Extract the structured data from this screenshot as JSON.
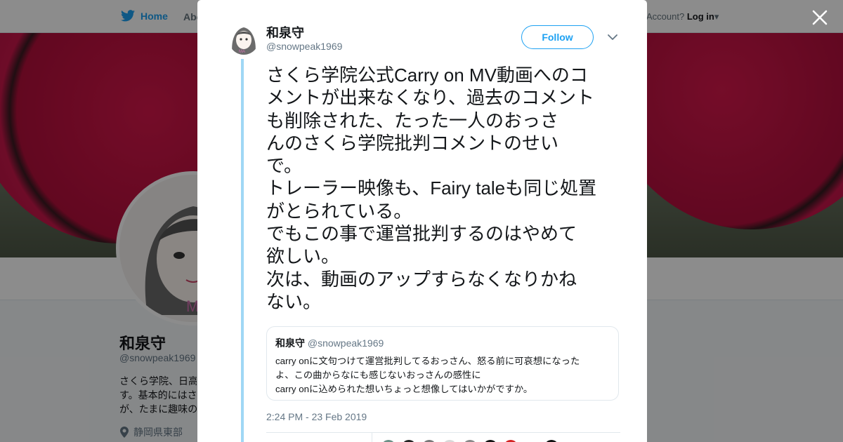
{
  "topnav": {
    "home_label": "Home",
    "about_label": "Abo",
    "account_prompt": "Account?",
    "login_label": "Log in"
  },
  "profile": {
    "name": "和泉守",
    "handle": "@snowpeak1969",
    "bio_lines": [
      "さくら学院、日高",
      "す。基本的にはさ",
      "が、たまに趣味の"
    ],
    "location": "静岡県東部"
  },
  "tweet": {
    "author_name": "和泉守",
    "author_handle": "@snowpeak1969",
    "follow_label": "Follow",
    "text_lines": [
      "さくら学院公式Carry on MV動画へのコ",
      "メントが出来なくなり、過去のコメント",
      "も削除された、たった一人のおっさ",
      "んのさくら学院批判コメントのせい",
      "で。",
      "トレーラー映像も、Fairy taleも同じ処置",
      "がとられている。",
      "でもこの事で運営批判するのはやめて",
      "欲しい。",
      "次は、動画のアップすらなくなりかね",
      "ない。"
    ],
    "timestamp": "2:24 PM - 23 Feb 2019"
  },
  "quoted_tweet": {
    "author_name": "和泉守",
    "author_handle": "@snowpeak1969",
    "text_lines": [
      "carry onに文句つけて運営批判してるおっさん、怒る前に可哀想になった",
      "よ、この曲からなにも感じないおっさんの感性に",
      "carry onに込められた想いちょっと想像してはいかがですか。"
    ]
  },
  "colors": {
    "accent": "#1da1f2",
    "text": "#14171a",
    "muted": "#657786",
    "thread_line": "#9fd7f5",
    "umbrella_red": "#c8154a"
  },
  "icons": {
    "home": "twitter-bird-icon",
    "close": "close-icon",
    "menu": "chevron-down-icon",
    "location": "location-pin-icon"
  }
}
